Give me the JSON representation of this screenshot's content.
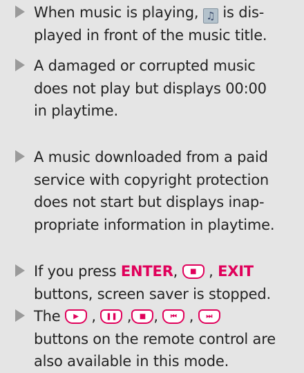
{
  "notes": [
    {
      "lines": [
        [
          "When music is playing, ",
          {
            "icon": "music-note-icon",
            "glyph": "♫"
          },
          " is dis-"
        ],
        [
          "played in front of the music title."
        ]
      ]
    },
    {
      "lines": [
        [
          "A damaged or corrupted music"
        ],
        [
          "does not play but displays 00:00"
        ],
        [
          "in playtime."
        ]
      ]
    },
    {
      "lines": [
        [
          "A music downloaded from a paid"
        ],
        [
          "service with copyright protection"
        ],
        [
          "does not start but displays inap-"
        ],
        [
          "propriate information in playtime."
        ]
      ]
    },
    {
      "lines": [
        [
          "If you press ",
          {
            "hl": "ENTER"
          },
          ", ",
          {
            "button": "stop",
            "glyph": "■"
          },
          " , ",
          {
            "hl": "EXIT"
          }
        ],
        [
          "buttons, screen saver is  stopped."
        ]
      ]
    },
    {
      "lines": [
        [
          "The ",
          {
            "button": "play",
            "glyph": "▶"
          },
          " , ",
          {
            "button": "pause",
            "glyph": "❚❚"
          },
          " ,",
          {
            "button": "stop",
            "glyph": "■"
          },
          ", ",
          {
            "button": "rewind",
            "glyph": "⏮"
          },
          " , ",
          {
            "button": "fast-forward",
            "glyph": "⏭"
          }
        ],
        [
          "buttons on the remote control are"
        ],
        [
          "also available in this mode."
        ]
      ]
    }
  ]
}
